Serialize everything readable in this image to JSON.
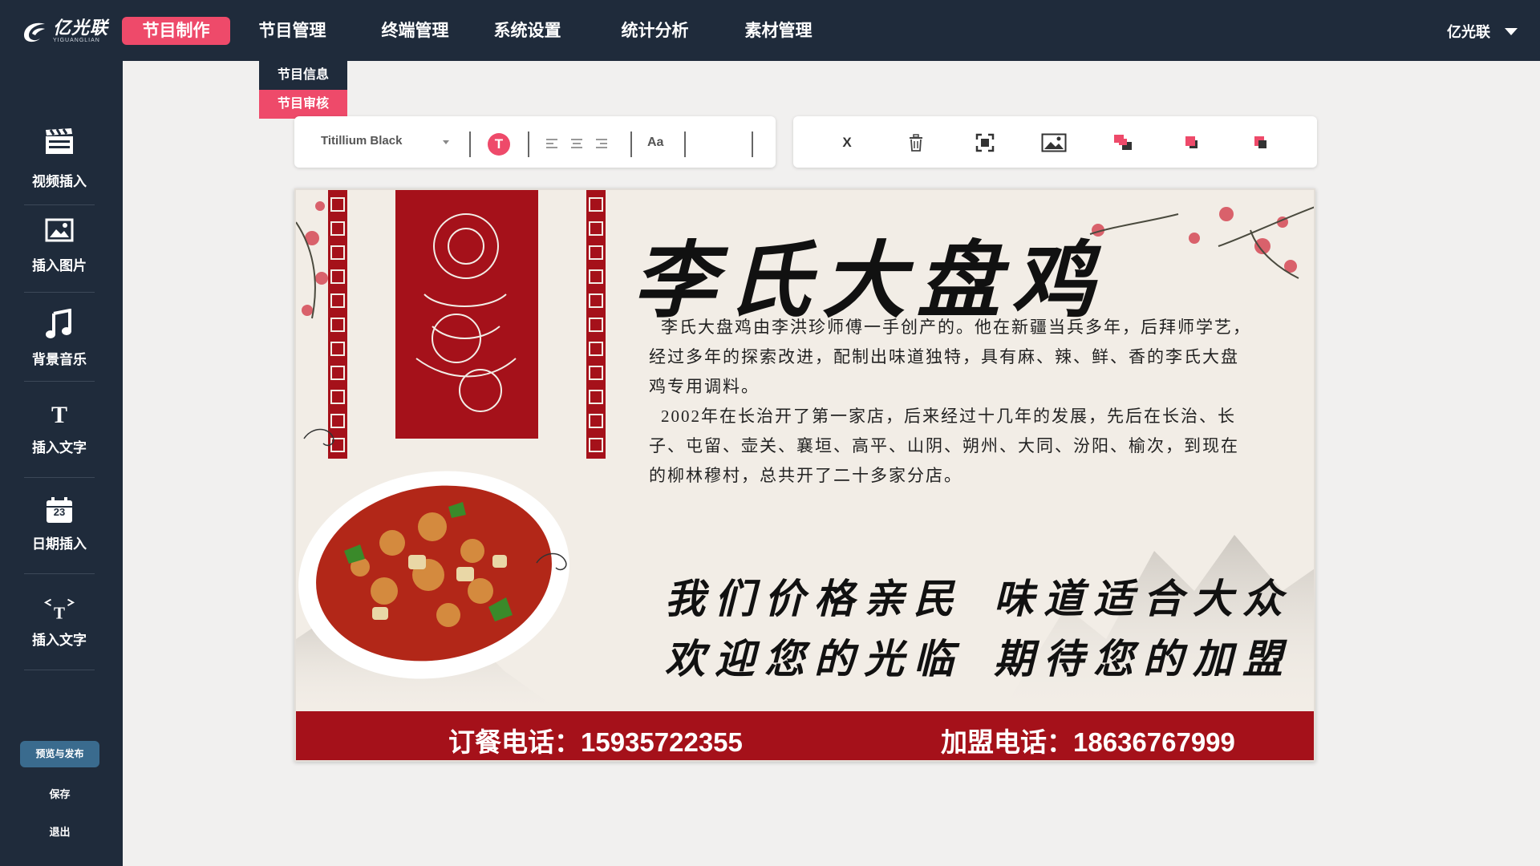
{
  "app": {
    "logo_cn": "亿光联",
    "logo_en": "YIGUANGLIAN"
  },
  "nav": {
    "items": [
      {
        "label": "节目制作",
        "active": true
      },
      {
        "label": "节目管理"
      },
      {
        "label": "终端管理"
      },
      {
        "label": "系统设置"
      },
      {
        "label": "统计分析"
      },
      {
        "label": "素材管理"
      }
    ],
    "submenu": [
      {
        "label": "节目信息"
      },
      {
        "label": "节目审核",
        "active": true
      }
    ],
    "user": "亿光联"
  },
  "sidebar": {
    "items": [
      {
        "label": "视频插入",
        "icon": "video-clapper-icon"
      },
      {
        "label": "插入图片",
        "icon": "image-icon"
      },
      {
        "label": "背景音乐",
        "icon": "music-note-icon"
      },
      {
        "label": "插入文字",
        "icon": "text-icon"
      },
      {
        "label": "日期插入",
        "icon": "calendar-icon",
        "icon_text": "23"
      },
      {
        "label": "插入文字",
        "icon": "text-code-icon"
      }
    ],
    "publish": "预览与发布",
    "save": "保存",
    "exit": "退出"
  },
  "toolbar": {
    "font": "Titillium Black",
    "text_color_button": "T",
    "font_size_button": "Aa",
    "tools": [
      "close-icon",
      "trash-icon",
      "fullscreen-icon",
      "image-icon",
      "layer-bring-front-icon",
      "layer-forward-icon",
      "layer-backward-icon"
    ],
    "close_label": "X"
  },
  "poster": {
    "title": "李氏大盘鸡",
    "paragraphs": [
      "李氏大盘鸡由李洪珍师傅一手创产的。他在新疆当兵多年，后拜师学艺，",
      "经过多年的探索改进，配制出味道独特，具有麻、辣、鲜、香的李氏大盘",
      "鸡专用调料。",
      "2002年在长治开了第一家店，后来经过十几年的发展，先后在长治、长",
      "子、屯留、壶关、襄垣、高平、山阴、朔州、大同、汾阳、榆次，到现在",
      "的柳林穆村，总共开了二十多家分店。"
    ],
    "slogans": [
      "我们价格亲民",
      "味道适合大众",
      "欢迎您的光临",
      "期待您的加盟"
    ],
    "order_phone": "订餐电话：15935722355",
    "join_phone": "加盟电话：18636767999",
    "colors": {
      "banner_red": "#a5111a",
      "accent_pink": "#ee4a6a",
      "nav_bg": "#1f2b3b"
    }
  }
}
